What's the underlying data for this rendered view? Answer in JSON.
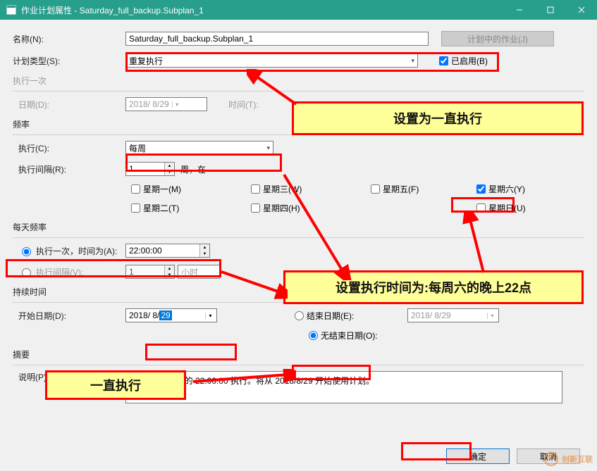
{
  "window": {
    "title": "作业计划属性 - Saturday_full_backup.Subplan_1"
  },
  "fields": {
    "name_label": "名称(N):",
    "name_value": "Saturday_full_backup.Subplan_1",
    "jobs_in_schedule_btn": "计划中的作业(J)",
    "schedule_type_label": "计划类型(S):",
    "schedule_type_value": "重复执行",
    "enabled_label": "已启用(B)"
  },
  "once_section": {
    "title": "执行一次",
    "date_label": "日期(D):",
    "date_value": "2018/ 8/29",
    "time_label": "时间(T):"
  },
  "freq_section": {
    "title": "频率",
    "occurs_label": "执行(C):",
    "occurs_value": "每周",
    "recurs_label": "执行间隔(R):",
    "recurs_value": "1",
    "recurs_suffix": "周，在",
    "mon": "星期一(M)",
    "tue": "星期二(T)",
    "wed": "星期三(W)",
    "thu": "星期四(H)",
    "fri": "星期五(F)",
    "sat": "星期六(Y)",
    "sun": "星期日(U)"
  },
  "daily_section": {
    "title": "每天频率",
    "once_label": "执行一次，时间为(A):",
    "once_value": "22:00:00",
    "every_label": "执行间隔(V):",
    "every_value": "1",
    "every_unit": "小时"
  },
  "duration_section": {
    "title": "持续时间",
    "start_label": "开始日期(D):",
    "start_value_prefix": "2018/ 8/",
    "start_value_sel": "29",
    "end_date_label": "结束日期(E):",
    "end_date_value": "2018/ 8/29",
    "no_end_label": "无结束日期(O):"
  },
  "summary_section": {
    "title": "摘要",
    "desc_label": "说明(P):",
    "desc_value": "在每周 星期六 的 22:00:00 执行。将从 2018/8/29 开始使用计划。"
  },
  "buttons": {
    "ok": "确定",
    "cancel": "取消"
  },
  "annotations": {
    "a1": "设置为一直执行",
    "a2": "设置执行时间为:每周六的晚上22点",
    "a3": "一直执行"
  },
  "watermark": "创新互联"
}
